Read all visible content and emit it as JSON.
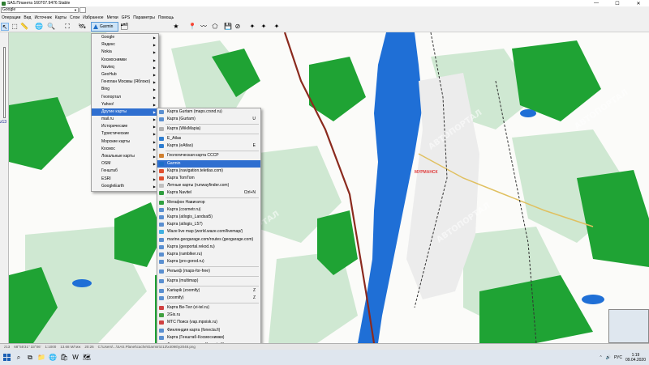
{
  "window": {
    "title": "SAS.Планета 160707.9476 Stable",
    "controls": [
      "—",
      "☐",
      "✕"
    ]
  },
  "map_selector": {
    "value": "Google"
  },
  "menubar": [
    "Операции",
    "Вид",
    "Источник",
    "Карты",
    "Слои",
    "Избранное",
    "Метки",
    "GPS",
    "Параметры",
    "Помощь"
  ],
  "toolbar": {
    "garmin_label": "Garmin"
  },
  "menu_maps": {
    "items": [
      {
        "label": "Google",
        "sub": true
      },
      {
        "label": "Яндекс",
        "sub": true
      },
      {
        "label": "Nokia",
        "sub": true
      },
      {
        "label": "Космоснимки",
        "sub": true
      },
      {
        "label": "Navteq",
        "sub": true
      },
      {
        "label": "GeoHub",
        "sub": true
      },
      {
        "label": "Генплан Москвы (Яблоко)",
        "sub": true
      },
      {
        "label": "Bing",
        "sub": true
      },
      {
        "label": "Геопортал",
        "sub": true
      },
      {
        "label": "Yahoo!",
        "sub": true
      },
      {
        "label": "Другие карты",
        "sub": true,
        "highlight": true
      },
      {
        "label": "mail.ru",
        "sub": true
      },
      {
        "label": "Исторические",
        "sub": true
      },
      {
        "label": "Туристические",
        "sub": true
      },
      {
        "label": "Морские карты",
        "sub": true
      },
      {
        "label": "Космос",
        "sub": true
      },
      {
        "label": "Локальные карты",
        "sub": true
      },
      {
        "label": "OSM",
        "sub": true
      },
      {
        "label": "Генштаб",
        "sub": true
      },
      {
        "label": "ESRI",
        "sub": true
      },
      {
        "label": "GoogleEarth",
        "sub": true
      }
    ]
  },
  "menu_other": {
    "items": [
      {
        "label": "Карта Gurtam (maps.crsnd.ru)",
        "shortcut": "",
        "icon_color": "#5a8fd0"
      },
      {
        "label": "Карта (Gurtam)",
        "shortcut": "U",
        "icon_color": "#5a8fd0"
      },
      {
        "sep": true
      },
      {
        "label": "Карта (WikiMapia)",
        "shortcut": "",
        "icon_color": "#b0b0b0"
      },
      {
        "sep": true
      },
      {
        "label": "E_Atlas",
        "shortcut": "",
        "icon_color": "#2e7dd0"
      },
      {
        "label": "Карта (eAtlas)",
        "shortcut": "E",
        "icon_color": "#2e7dd0"
      },
      {
        "sep": true
      },
      {
        "label": "Геологическая карта СССР",
        "shortcut": "",
        "icon_color": "#d08030"
      },
      {
        "label": "Garmin",
        "shortcut": "",
        "icon_color": "#1e6ec8",
        "highlight": true
      },
      {
        "label": "Карта (navigation.teletlas.com)",
        "shortcut": "",
        "icon_color": "#e05030"
      },
      {
        "label": "Карта TomTom",
        "shortcut": "",
        "icon_color": "#e05030"
      },
      {
        "label": "Летные карты (runwayfinder.com)",
        "shortcut": "",
        "icon_color": "#c0c0c0"
      },
      {
        "label": "Карта Navitel",
        "shortcut": "Ctrl+N",
        "icon_color": "#2e9d3e"
      },
      {
        "sep": true
      },
      {
        "label": "Мегафон Навигатор",
        "shortcut": "",
        "icon_color": "#30a040"
      },
      {
        "label": "Карта (cosmetr.ru)",
        "shortcut": "",
        "icon_color": "#5a8fd0"
      },
      {
        "label": "Карта (atlogis_Landsat5)",
        "shortcut": "",
        "icon_color": "#5a8fd0"
      },
      {
        "label": "Карта (atlogis_L57)",
        "shortcut": "",
        "icon_color": "#5a8fd0"
      },
      {
        "label": "Waze live map (world.waze.com/livemap/)",
        "shortcut": "",
        "icon_color": "#40b0e0"
      },
      {
        "label": "marine.geogarage.com/routes (geogarage.com)",
        "shortcut": "",
        "icon_color": "#5a8fd0"
      },
      {
        "label": "Карта (geoportal.rekod.ru)",
        "shortcut": "",
        "icon_color": "#5a8fd0"
      },
      {
        "label": "Карта (ramblker.ru)",
        "shortcut": "",
        "icon_color": "#5a8fd0"
      },
      {
        "label": "Карта (pro-gorod.ru)",
        "shortcut": "",
        "icon_color": "#5a8fd0"
      },
      {
        "sep": true
      },
      {
        "label": "Рельеф (maps-for-free)",
        "shortcut": "",
        "icon_color": "#5a8fd0"
      },
      {
        "sep": true
      },
      {
        "label": "Карта (multimap)",
        "shortcut": "",
        "icon_color": "#5a8fd0"
      },
      {
        "sep": true
      },
      {
        "label": "Kartapik (zoomify)",
        "shortcut": "Z",
        "icon_color": "#5a8fd0"
      },
      {
        "label": "(zoomify)",
        "shortcut": "Z",
        "icon_color": "#5a8fd0"
      },
      {
        "sep": true
      },
      {
        "label": "Карта Bи-Тел (vi-tel.ru)",
        "shortcut": "",
        "icon_color": "#d04040"
      },
      {
        "label": "2Gis.ru",
        "shortcut": "",
        "icon_color": "#40a040"
      },
      {
        "label": "МТС Поиск (vap.mpoisk.ru)",
        "shortcut": "",
        "icon_color": "#d04040"
      },
      {
        "label": "Финляндия карта (fonecta.fi)",
        "shortcut": "",
        "icon_color": "#5a8fd0"
      },
      {
        "label": "Карта (Генштаб-Космоснимки)",
        "shortcut": "",
        "icon_color": "#5a8fd0"
      },
      {
        "label": "Финляндия спутник (fonecta.fi)",
        "shortcut": "",
        "icon_color": "#5a8fd0"
      }
    ]
  },
  "map_labels": {
    "city": "МУРМАНСК"
  },
  "leftbar": {
    "zoom_label": "z13"
  },
  "statusbar": {
    "zoom": "z13",
    "coords": "68°55'31\" 33°06'",
    "scale": "1:1000",
    "info": "13.68 M/тиж",
    "time": "20:26",
    "path": "C:\\Users\\...\\SAS.Planet\\cache\\Garmin\\z13\\x4096\\y2048.png"
  },
  "taskbar": {
    "time": "1:19",
    "date": "09.04.2020",
    "lang": "РУС"
  }
}
